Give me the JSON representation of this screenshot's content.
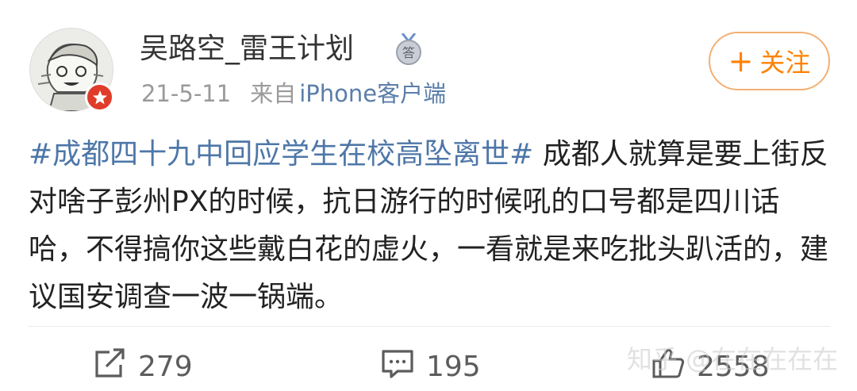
{
  "post": {
    "author": {
      "name": "吴路空_雷王计划",
      "medal_glyph": "答"
    },
    "date": "21-5-11",
    "source_prefix": "来自",
    "client": "iPhone客户端",
    "follow_button": {
      "plus": "+",
      "label": "关注"
    },
    "topic": "#成都四十九中回应学生在校高坠离世#",
    "body": " 成都人就算是要上街反对啥子彭州PX的时候，抗日游行的时候吼的口号都是四川话哈，不得搞你这些戴白花的虚火，一看就是来吃批头趴活的，建议国安调查一波一锅端。"
  },
  "actions": {
    "share_count": "279",
    "comment_count": "195",
    "like_count": "2558"
  },
  "watermark": "知乎 @在在在在在",
  "colors": {
    "accent_orange": "#ff8200",
    "link_blue": "#4e77a8",
    "client_blue": "#5b7ea8",
    "verified_red": "#e03c2a"
  }
}
